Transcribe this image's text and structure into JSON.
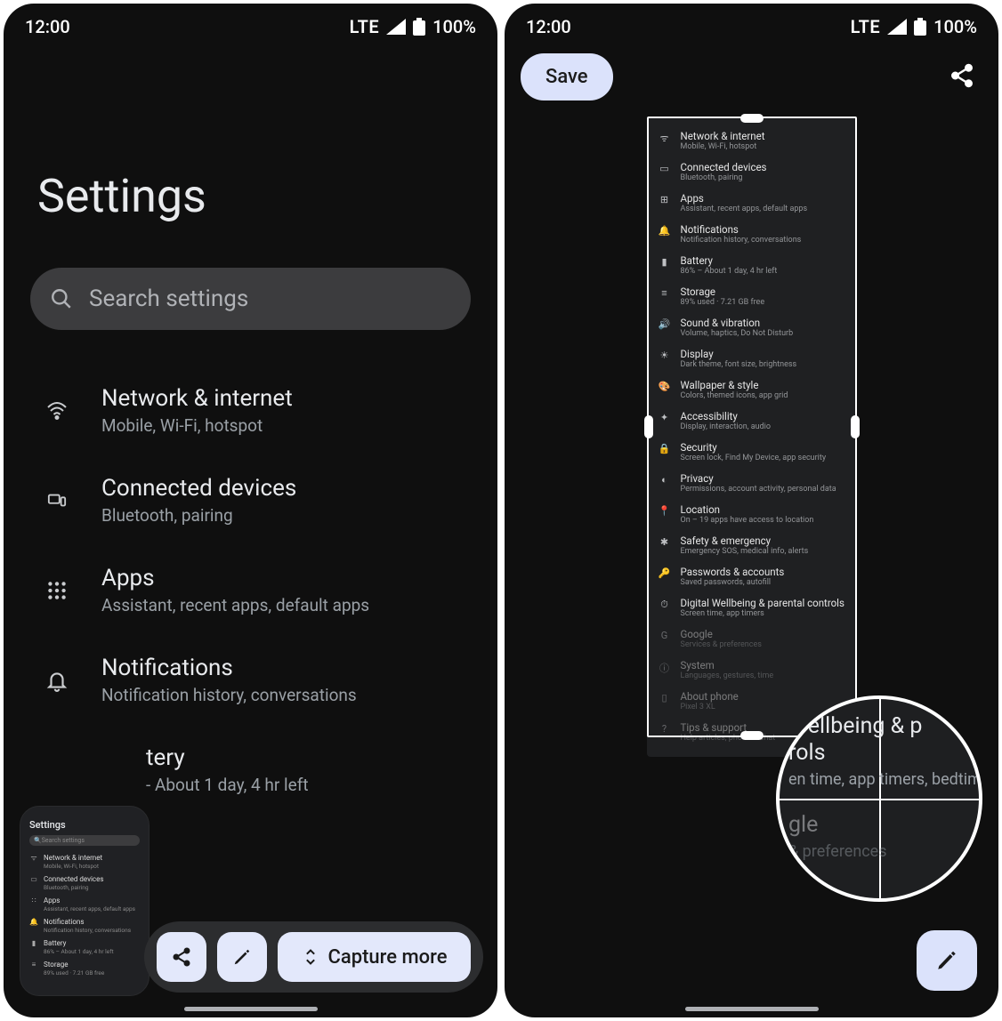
{
  "status": {
    "time": "12:00",
    "network": "LTE",
    "battery": "100%"
  },
  "left": {
    "title": "Settings",
    "search_placeholder": "Search settings",
    "items": [
      {
        "title": "Network & internet",
        "subtitle": "Mobile, Wi-Fi, hotspot"
      },
      {
        "title": "Connected devices",
        "subtitle": "Bluetooth, pairing"
      },
      {
        "title": "Apps",
        "subtitle": "Assistant, recent apps, default apps"
      },
      {
        "title": "Notifications",
        "subtitle": "Notification history, conversations"
      }
    ],
    "partial_battery": {
      "title_fragment": "tery",
      "subtitle_fragment": "- About 1 day, 4 hr left"
    },
    "thumb": {
      "heading": "Settings",
      "search": "Search settings",
      "rows": [
        {
          "t": "Network & internet",
          "s": "Mobile, Wi-Fi, hotspot"
        },
        {
          "t": "Connected devices",
          "s": "Bluetooth, pairing"
        },
        {
          "t": "Apps",
          "s": "Assistant, recent apps, default apps"
        },
        {
          "t": "Notifications",
          "s": "Notification history, conversations"
        },
        {
          "t": "Battery",
          "s": "86% – About 1 day, 4 hr left"
        },
        {
          "t": "Storage",
          "s": "89% used · 7.21 GB free"
        }
      ]
    },
    "actions": {
      "capture_more": "Capture more"
    }
  },
  "right": {
    "save": "Save",
    "long_items": [
      {
        "t": "Network & internet",
        "s": "Mobile, Wi-Fi, hotspot"
      },
      {
        "t": "Connected devices",
        "s": "Bluetooth, pairing"
      },
      {
        "t": "Apps",
        "s": "Assistant, recent apps, default apps"
      },
      {
        "t": "Notifications",
        "s": "Notification history, conversations"
      },
      {
        "t": "Battery",
        "s": "86% – About 1 day, 4 hr left"
      },
      {
        "t": "Storage",
        "s": "89% used · 7.21 GB free"
      },
      {
        "t": "Sound & vibration",
        "s": "Volume, haptics, Do Not Disturb"
      },
      {
        "t": "Display",
        "s": "Dark theme, font size, brightness"
      },
      {
        "t": "Wallpaper & style",
        "s": "Colors, themed icons, app grid"
      },
      {
        "t": "Accessibility",
        "s": "Display, interaction, audio"
      },
      {
        "t": "Security",
        "s": "Screen lock, Find My Device, app security"
      },
      {
        "t": "Privacy",
        "s": "Permissions, account activity, personal data"
      },
      {
        "t": "Location",
        "s": "On – 19 apps have access to location"
      },
      {
        "t": "Safety & emergency",
        "s": "Emergency SOS, medical info, alerts"
      },
      {
        "t": "Passwords & accounts",
        "s": "Saved passwords, autofill"
      },
      {
        "t": "Digital Wellbeing & parental controls",
        "s": "Screen time, app timers"
      },
      {
        "t": "Google",
        "s": "Services & preferences"
      },
      {
        "t": "System",
        "s": "Languages, gestures, time"
      },
      {
        "t": "About phone",
        "s": "Pixel 3 XL"
      },
      {
        "t": "Tips & support",
        "s": "Help articles, phone & chat"
      }
    ],
    "loupe": {
      "l1a": "Wellbeing & p",
      "l1b": "rols",
      "l1c": "en time, app timers, bedtim",
      "l2a": "gle",
      "l2b": "& preferences"
    }
  }
}
